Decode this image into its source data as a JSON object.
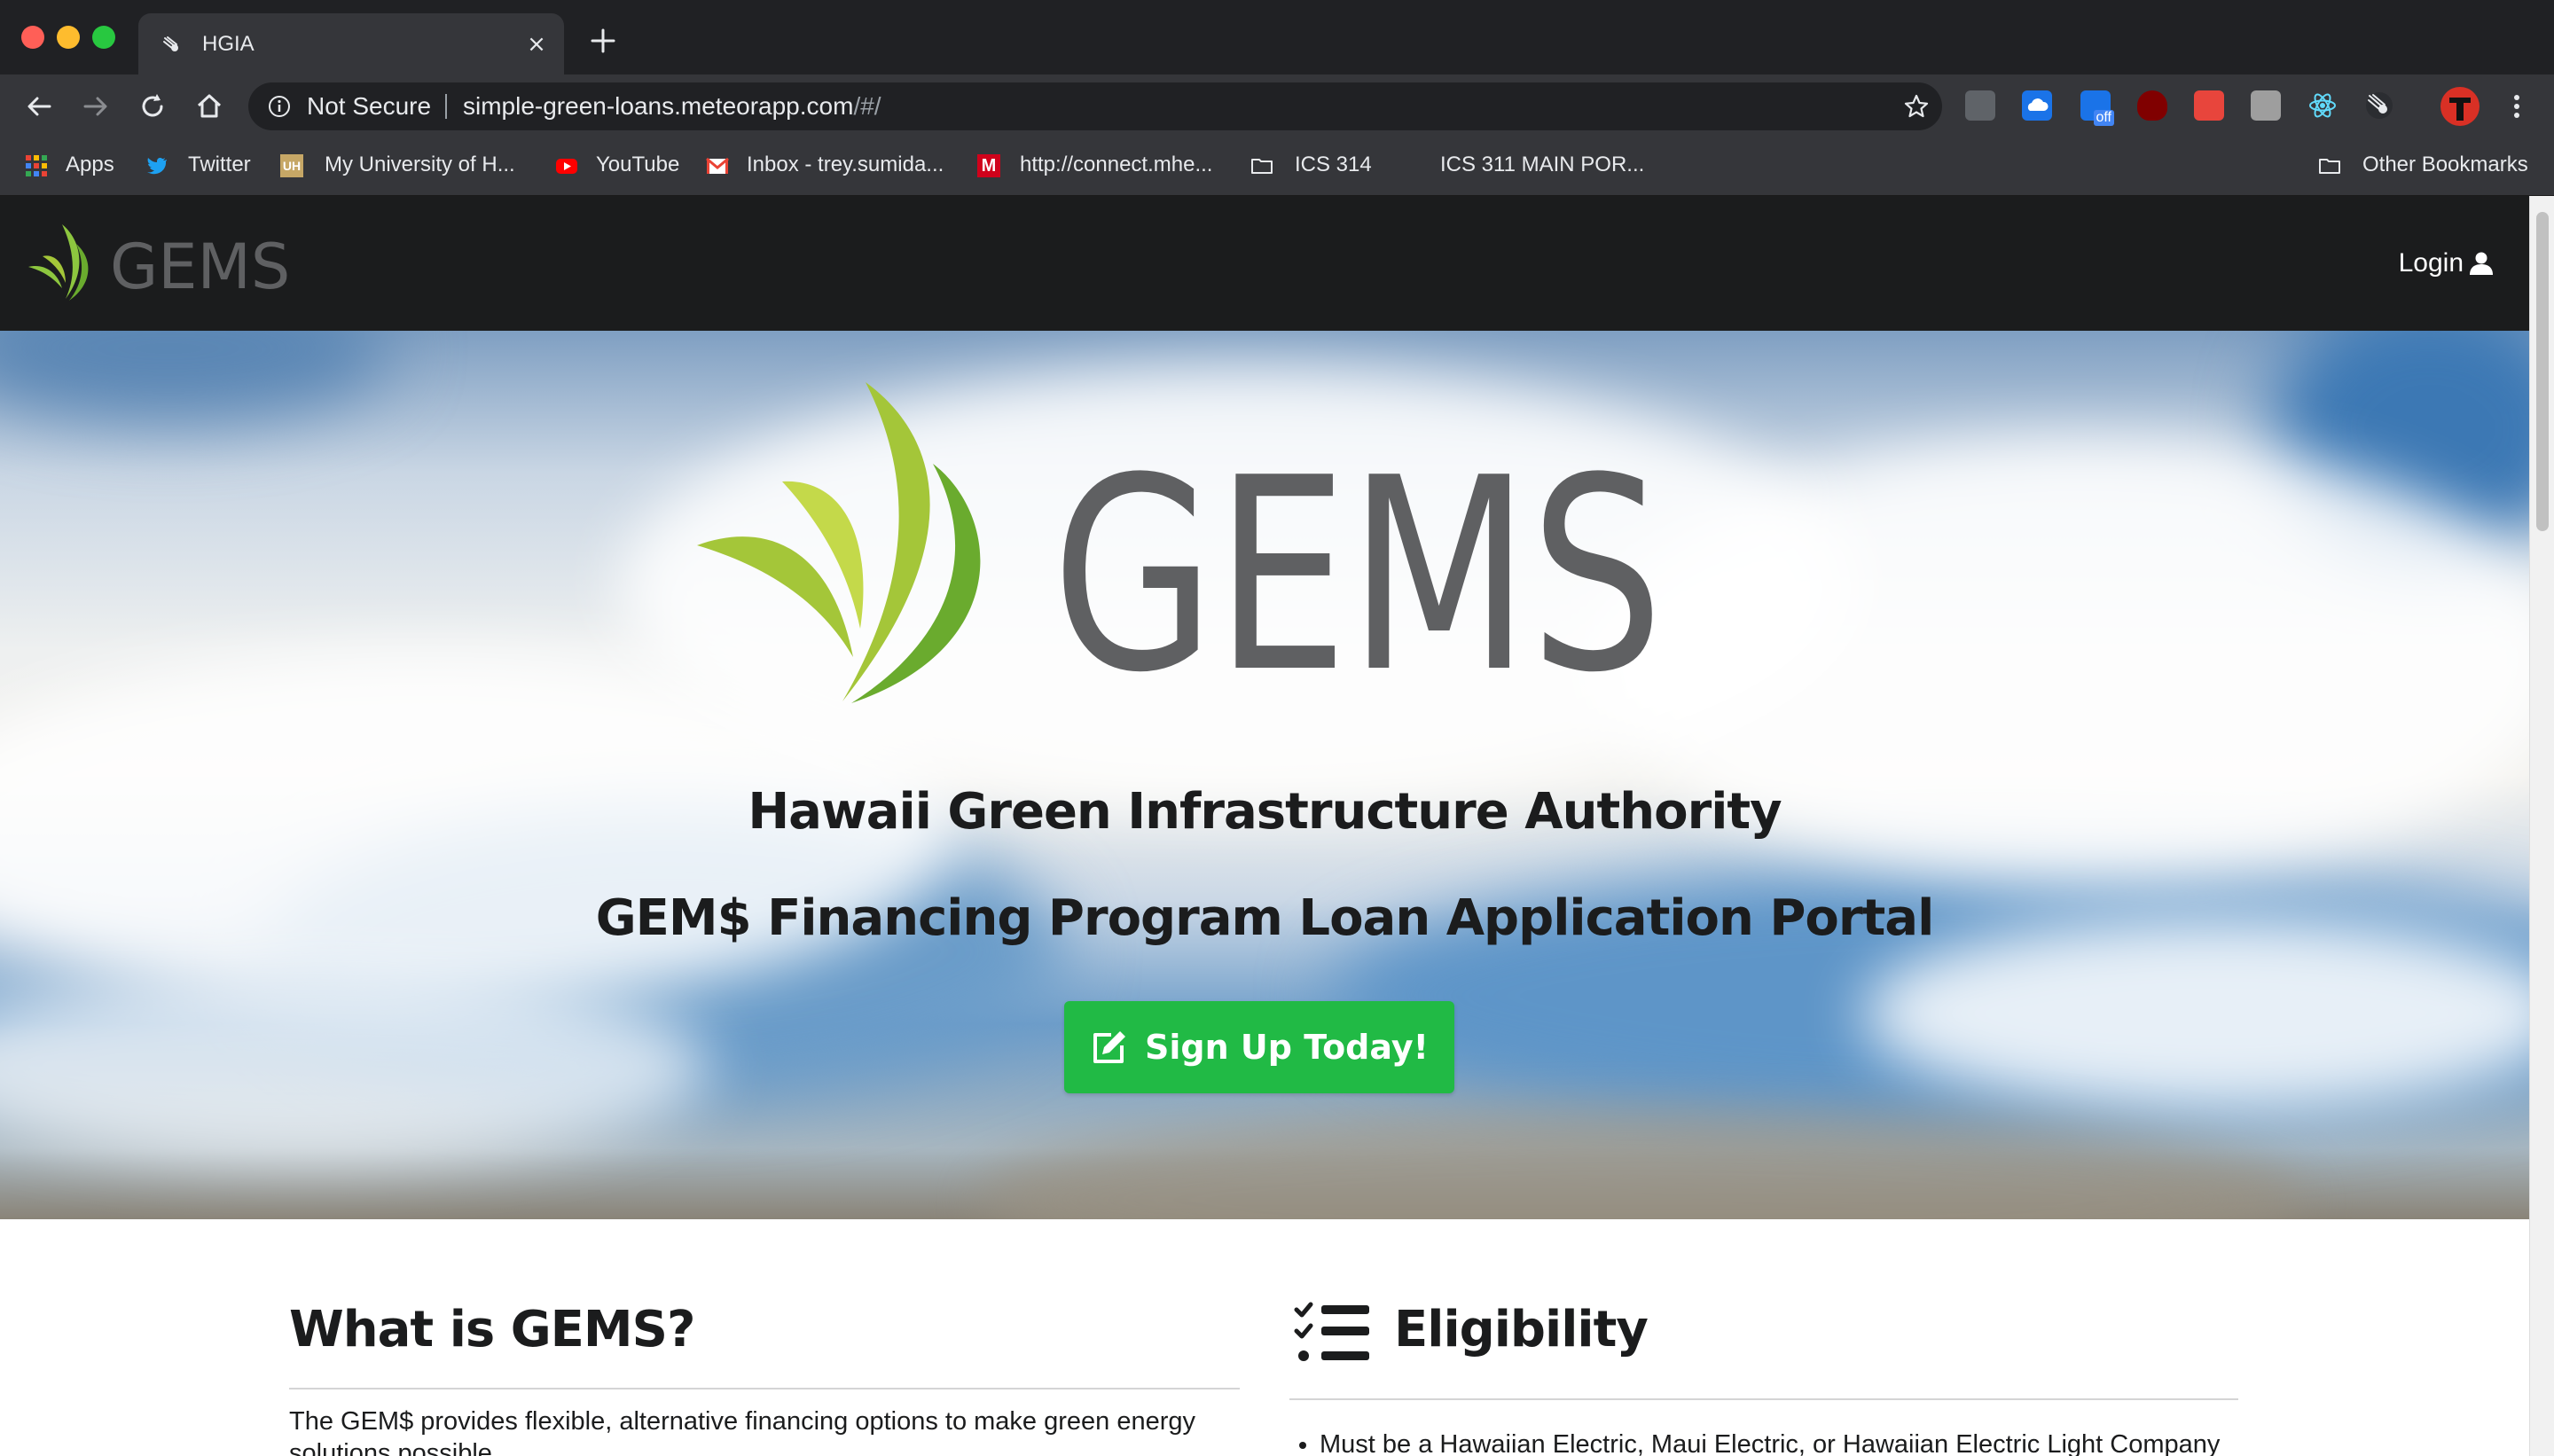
{
  "browser": {
    "tab": {
      "title": "HGIA",
      "close": "×"
    },
    "new_tab": "+",
    "omnibox": {
      "security_label": "Not Secure",
      "url_host": "simple-green-loans.meteorapp.com",
      "url_path": "/#/"
    },
    "bookmarks": [
      {
        "label": "Apps",
        "icon": "apps-grid-icon"
      },
      {
        "label": "Twitter",
        "icon": "twitter-icon"
      },
      {
        "label": "My University of H...",
        "icon": "uh-icon"
      },
      {
        "label": "YouTube",
        "icon": "youtube-icon"
      },
      {
        "label": "Inbox - trey.sumida...",
        "icon": "gmail-icon"
      },
      {
        "label": "http://connect.mhe...",
        "icon": "mcgraw-hill-icon"
      },
      {
        "label": "ICS 314",
        "icon": "folder-icon"
      },
      {
        "label": "ICS 311 MAIN POR...",
        "icon": ""
      }
    ],
    "other_bookmarks": "Other Bookmarks",
    "extension_badge": "off"
  },
  "site": {
    "nav": {
      "brand": "GEMS",
      "login_label": "Login"
    },
    "hero": {
      "logo_text": "GEMS",
      "title": "Hawaii Green Infrastructure Authority",
      "subtitle": "GEM$ Financing Program Loan Application Portal",
      "cta_label": "Sign Up Today!"
    },
    "what": {
      "title": "What is GEMS?",
      "body": "The GEM$ provides flexible, alternative financing options to make green energy solutions possible."
    },
    "eligibility": {
      "title": "Eligibility",
      "items": [
        "Must be a Hawaiian Electric, Maui Electric, or Hawaiian Electric Light Company"
      ]
    }
  },
  "colors": {
    "brand_green": "#21ba45",
    "logo_gray": "#5f6062",
    "logo_lime": "#a4c639",
    "nav_dark": "#1b1c1d",
    "chrome_dark": "#202124"
  }
}
